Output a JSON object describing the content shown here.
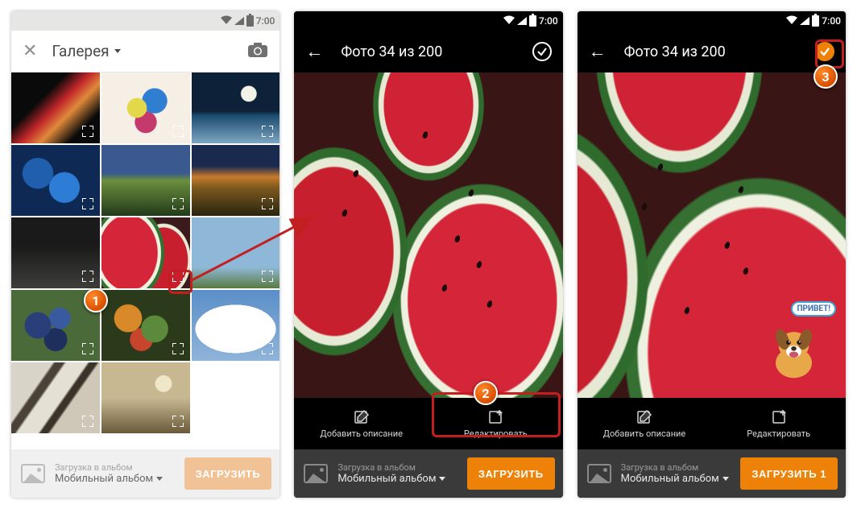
{
  "status": {
    "time": "7:00"
  },
  "screen1": {
    "title": "Галерея",
    "bottom": {
      "small": "Загрузка в альбом",
      "album": "Мобильный альбом",
      "upload": "ЗАГРУЗИТЬ"
    },
    "thumbs": [
      {
        "name": "smoke-red",
        "bg": "linear-gradient(135deg,#0a0a0a 35%,#c0262a 50%,#e0893a 62%,#0a0a0a 80%)"
      },
      {
        "name": "splash-colors",
        "bg": "radial-gradient(circle at 40% 50%,#e2d84a 0 15%,transparent 16%),radial-gradient(circle at 60% 40%,#2f7ed1 0 18%,transparent 19%),radial-gradient(circle at 50% 70%,#c43a6d 0 16%,transparent 17%),#f5efe6"
      },
      {
        "name": "moon-clouds",
        "bg": "radial-gradient(circle at 65% 30%,#f2f2e6 0 10%,transparent 11%),linear-gradient(#0d2238 0 55%,#1a4a6f 60%,#7ea6c2 100%)"
      },
      {
        "name": "blue-coral",
        "bg": "radial-gradient(circle at 30% 40%,#1f5fae 0 20%,transparent 21%),radial-gradient(circle at 60% 60%,#2d7cd6 0 22%,transparent 23%),#0e2a54"
      },
      {
        "name": "rainbow-field",
        "bg": "linear-gradient(180deg,#3a5a8f 0 40%,#6b8f3d 50%,#223a1a 100%),radial-gradient(ellipse 4px 60px at 48% 40%,#d4513a 0 100%,transparent)"
      },
      {
        "name": "sunset-field",
        "bg": "linear-gradient(180deg,#1a2a4f 0 30%,#c97a2d 45%,#7d5a1d 60%,#2a2410 100%)"
      },
      {
        "name": "rain-dark",
        "bg": "linear-gradient(180deg,#1a1a1a 0 40%,#3d3d3a 100%)"
      },
      {
        "name": "watermelon",
        "bg": "radial-gradient(ellipse 70px 90px at 30% 50%,#d42638 0 52%,#eef1df 53% 58%,#356f31 59% 64%,transparent 65%),radial-gradient(ellipse 60px 80px at 70% 60%,#c81f2e 0 50%,#e6ead4 51% 56%,transparent 57%),#3a1a1a"
      },
      {
        "name": "tree-sky",
        "bg": "linear-gradient(180deg,#8fb8d8 0 70%,#5a7a42 100%)"
      },
      {
        "name": "blueberries",
        "bg": "radial-gradient(circle at 30% 50%,#2a3f7a 0 18%,transparent 19%),radial-gradient(circle at 55% 40%,#3a5aa0 0 16%,transparent 17%),radial-gradient(circle at 50% 70%,#1f2f5d 0 17%,transparent 18%),#4a6a3a"
      },
      {
        "name": "fruits-mix",
        "bg": "radial-gradient(circle at 30% 40%,#d88a2a 0 18%,transparent 19%),radial-gradient(circle at 60% 55%,#5a8a3a 0 20%,transparent 21%),radial-gradient(circle at 45% 70%,#c7452d 0 16%,transparent 17%),#2a3a1a"
      },
      {
        "name": "clouds-white",
        "bg": "radial-gradient(ellipse 50px 30px at 50% 55%,#fff 0 100%,transparent),linear-gradient(#5a8fc8,#8fb4da)"
      },
      {
        "name": "abstract-lines",
        "bg": "linear-gradient(125deg,#d8d4c8 0 30%,#4a4238 32% 38%,#e5e0d4 40% 55%,#3a332a 57% 62%,#cfc8b8 64%)"
      },
      {
        "name": "bokeh-field",
        "bg": "radial-gradient(circle at 70% 30%,#f0e6c8 0 10%,transparent 11%),linear-gradient(180deg,#c8b892 0 50%,#6a5a3a 100%)"
      },
      {
        "name": "empty",
        "bg": "#fff"
      }
    ]
  },
  "screen2": {
    "title": "Фото 34 из 200",
    "desc": "Добавить описание",
    "edit": "Редактировать",
    "bottom": {
      "small": "Загрузка в альбом",
      "album": "Мобильный альбом",
      "upload": "ЗАГРУЗИТЬ"
    }
  },
  "screen3": {
    "title": "Фото 34 из 200",
    "desc": "Добавить описание",
    "edit": "Редактировать",
    "sticker": "ПРИВЕТ!",
    "bottom": {
      "small": "Загрузка в альбом",
      "album": "Мобильный альбом",
      "upload": "ЗАГРУЗИТЬ 1"
    }
  },
  "markers": {
    "m1": "1",
    "m2": "2",
    "m3": "3"
  }
}
